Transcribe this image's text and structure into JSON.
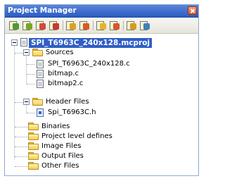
{
  "panel": {
    "title": "Project Manager"
  },
  "toolbar": {
    "buttons": [
      {
        "name": "new-project-button",
        "icon": "new-project-icon",
        "color": "#4f9a35"
      },
      {
        "name": "open-project-button",
        "icon": "open-project-icon",
        "color": "#79a32d"
      },
      {
        "name": "save-project-button",
        "icon": "save-project-icon",
        "color": "#d4463c"
      },
      {
        "name": "close-project-button",
        "icon": "close-project-icon",
        "color": "#c8382e"
      },
      {
        "name": "add-file-button",
        "icon": "add-file-icon",
        "color": "#e0a020"
      },
      {
        "name": "remove-file-button",
        "icon": "remove-file-icon",
        "color": "#d85a25"
      },
      {
        "name": "add-folder-button",
        "icon": "add-folder-icon",
        "color": "#e6b22e"
      },
      {
        "name": "remove-folder-button",
        "icon": "remove-folder-icon",
        "color": "#d9542d"
      },
      {
        "name": "edit-project-button",
        "icon": "edit-pencil-icon",
        "color": "#d99a20"
      },
      {
        "name": "build-project-button",
        "icon": "build-icon",
        "color": "#3f7fbf"
      }
    ]
  },
  "tree": {
    "project": "SPI_T6963C_240x128.mcproj",
    "groups": {
      "sources": "Sources",
      "header_files": "Header Files",
      "binaries": "Binaries",
      "project_level_defines": "Project level defines",
      "image_files": "Image Files",
      "output_files": "Output Files",
      "other_files": "Other Files"
    },
    "source_files": [
      "SPI_T6963C_240x128.c",
      "bitmap.c",
      "bitmap2.c"
    ],
    "header_files": [
      "Spi_T6963C.h"
    ]
  }
}
